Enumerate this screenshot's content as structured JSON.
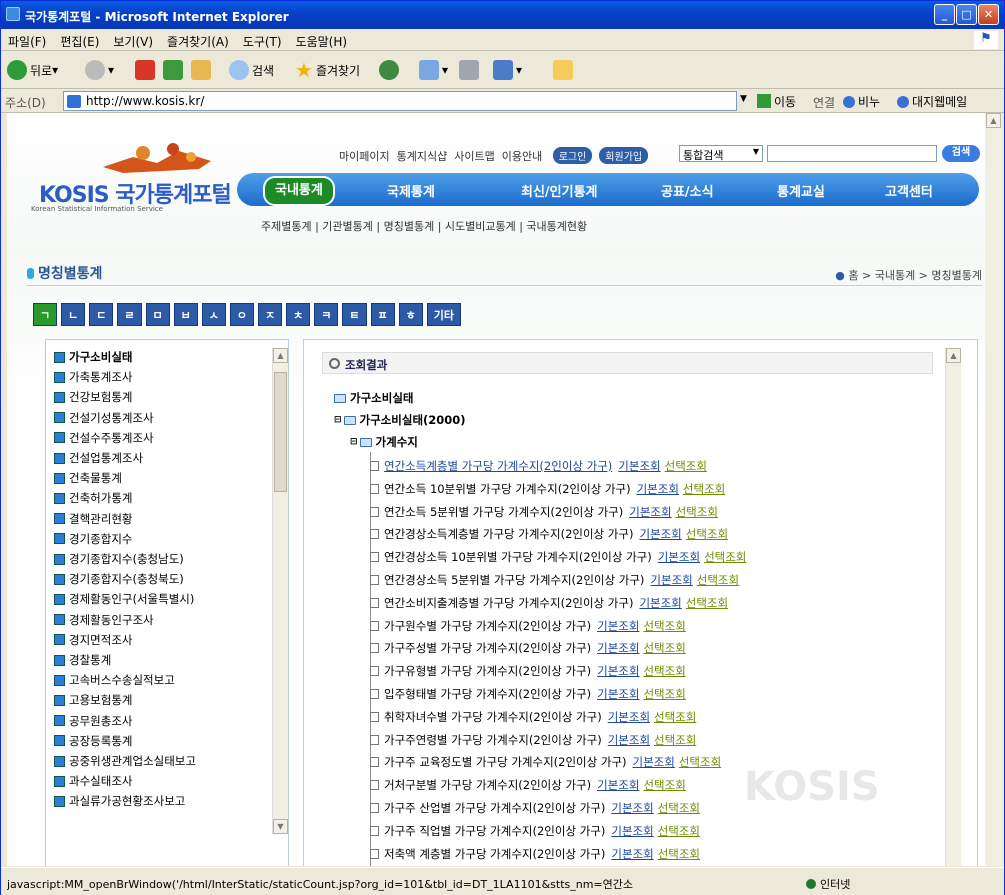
{
  "window": {
    "title": "국가통계포털 - Microsoft Internet Explorer"
  },
  "menu": [
    "파일(F)",
    "편집(E)",
    "보기(V)",
    "즐겨찾기(A)",
    "도구(T)",
    "도움말(H)"
  ],
  "toolbar": {
    "back": "뒤로",
    "search": "검색",
    "favorites": "즐겨찾기"
  },
  "address": {
    "label": "주소(D)",
    "url": "http://www.kosis.kr/",
    "go": "이동",
    "links_label": "연결",
    "link1": "비누",
    "link2": "대지웹메일"
  },
  "site": {
    "logo_text": "KOSIS 국가통계포털",
    "logo_sub": "Korean Statistical Information Service",
    "top_links": [
      "마이페이지",
      "통계지식샵",
      "사이트맵",
      "이용안내"
    ],
    "login": "로그인",
    "join": "회원가입",
    "search_select": "통합검색",
    "search_btn": "검색",
    "main_nav": [
      "국내통계",
      "국제통계",
      "최신/인기통계",
      "공표/소식",
      "통계교실",
      "고객센터"
    ],
    "sub_nav": "주제별통계  |  기관별통계  |  명칭별통계  |  시도별비교통계  |  국내통계현황",
    "page_title": "명칭별통계",
    "breadcrumb": "홈 > 국내통계 > 명칭별통계",
    "tabs": [
      "ㄱ",
      "ㄴ",
      "ㄷ",
      "ㄹ",
      "ㅁ",
      "ㅂ",
      "ㅅ",
      "ㅇ",
      "ㅈ",
      "ㅊ",
      "ㅋ",
      "ㅌ",
      "ㅍ",
      "ㅎ",
      "기타"
    ]
  },
  "left_list": [
    "가구소비실태",
    "가축통계조사",
    "건강보험통계",
    "건설기성통계조사",
    "건설수주통계조사",
    "건설업통계조사",
    "건축물통계",
    "건축허가통계",
    "결핵관리현황",
    "경기종합지수",
    "경기종합지수(충청남도)",
    "경기종합지수(충청북도)",
    "경제활동인구(서울특별시)",
    "경제활동인구조사",
    "경지면적조사",
    "경찰통계",
    "고속버스수송실적보고",
    "고용보험통계",
    "공무원총조사",
    "공장등록통계",
    "공중위생관계업소실태보고",
    "과수실태조사",
    "과실류가공현황조사보고"
  ],
  "results": {
    "header": "조회결과",
    "root": "가구소비실태",
    "sub": "가구소비실태(2000)",
    "group": "가계수지",
    "basic": "기본조회",
    "select": "선택조회",
    "items": [
      "연간소득계층별 가구당 가계수지(2인이상 가구)",
      "연간소득 10분위별 가구당 가계수지(2인이상 가구)",
      "연간소득 5분위별 가구당 가계수지(2인이상 가구)",
      "연간경상소득계층별 가구당 가계수지(2인이상 가구)",
      "연간경상소득 10분위별 가구당 가계수지(2인이상 가구)",
      "연간경상소득 5분위별 가구당 가계수지(2인이상 가구)",
      "연간소비지출계층별 가구당 가계수지(2인이상 가구)",
      "가구원수별 가구당 가계수지(2인이상 가구)",
      "가구주성별 가구당 가계수지(2인이상 가구)",
      "가구유형별 가구당 가계수지(2인이상 가구)",
      "입주형태별 가구당 가계수지(2인이상 가구)",
      "취학자녀수별 가구당 가계수지(2인이상 가구)",
      "가구주연령별 가구당 가계수지(2인이상 가구)",
      "가구주 교육정도별 가구당 가계수지(2인이상 가구)",
      "거처구분별 가구당 가계수지(2인이상 가구)",
      "가구주 산업별 가구당 가계수지(2인이상 가구)",
      "가구주 직업별 가구당 가계수지(2인이상 가구)",
      "저축액 계층별 가구당 가계수지(2인이상 가구)"
    ]
  },
  "status": {
    "text": "javascript:MM_openBrWindow('/html/InterStatic/staticCount.jsp?org_id=101&tbl_id=DT_1LA1101&stts_nm=연간소",
    "zone": "인터넷"
  }
}
